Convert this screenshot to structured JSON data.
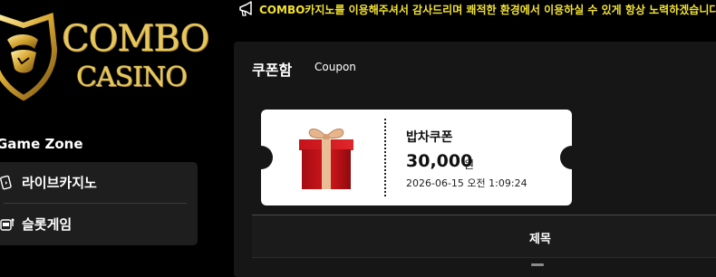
{
  "brand": {
    "name_line1": "COMBO",
    "name_line2": "CASINO",
    "colors": {
      "gold": "#e8c65a",
      "shield_gold": "#d9a935"
    }
  },
  "notice": {
    "icon": "megaphone-icon",
    "text": "COMBO카지노를 이용해주셔서 감사드리며 쾌적한 환경에서 이용하실 수 있게 항상 노력하겠습니다",
    "color": "#f2e230"
  },
  "sidebar": {
    "section_title": "Game Zone",
    "items": [
      {
        "label": "라이브카지노",
        "icon": "cards-icon"
      },
      {
        "label": "슬롯게임",
        "icon": "slot-machine-icon"
      }
    ]
  },
  "main": {
    "title": "쿠폰함",
    "subtitle": "Coupon",
    "coupon": {
      "icon": "gift-box-icon",
      "name": "밥차쿠폰",
      "amount": "30,000",
      "unit": "원",
      "date": "2026-06-15 오전 1:09:24"
    },
    "table": {
      "header_title": "제목"
    }
  }
}
